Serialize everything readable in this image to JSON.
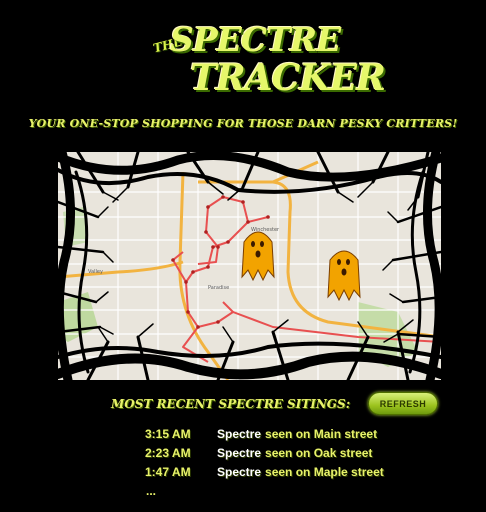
{
  "logo": {
    "the": "THE",
    "spectre": "SPECTRE",
    "tracker": "TRACKER"
  },
  "tagline": "Your one-stop shopping for those darn pesky critters!",
  "map": {
    "labels": {
      "paradise": "Paradise",
      "winchester": "Winchester",
      "valley": "Valley"
    },
    "ghost_color": "#f2a300",
    "route_color": "#e85050",
    "road_color": "#f2b340"
  },
  "sightings": {
    "heading": "Most Recent Spectre Sitings:",
    "refresh_label": "REFRESH",
    "items": [
      {
        "time": "3:15 AM",
        "name": "Spectre",
        "detail": "seen on Main street"
      },
      {
        "time": "2:23 AM",
        "name": "Spectre",
        "detail": "seen on Oak street"
      },
      {
        "time": "1:47 AM",
        "name": "Spectre",
        "detail": "seen on Maple street"
      }
    ],
    "more": "..."
  }
}
